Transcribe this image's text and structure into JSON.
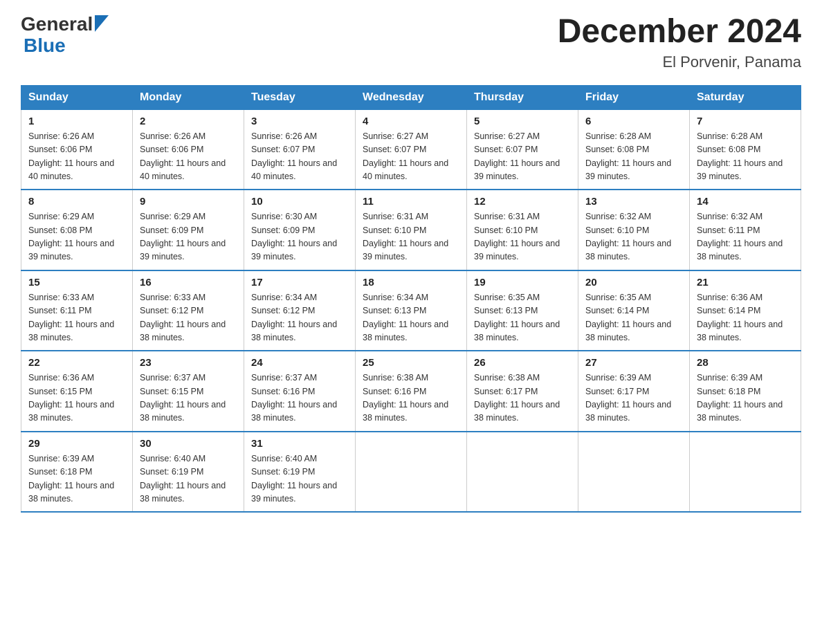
{
  "header": {
    "logo_general": "General",
    "logo_blue": "Blue",
    "title": "December 2024",
    "location": "El Porvenir, Panama"
  },
  "days_of_week": [
    "Sunday",
    "Monday",
    "Tuesday",
    "Wednesday",
    "Thursday",
    "Friday",
    "Saturday"
  ],
  "weeks": [
    [
      {
        "day": "1",
        "sunrise": "6:26 AM",
        "sunset": "6:06 PM",
        "daylight": "11 hours and 40 minutes."
      },
      {
        "day": "2",
        "sunrise": "6:26 AM",
        "sunset": "6:06 PM",
        "daylight": "11 hours and 40 minutes."
      },
      {
        "day": "3",
        "sunrise": "6:26 AM",
        "sunset": "6:07 PM",
        "daylight": "11 hours and 40 minutes."
      },
      {
        "day": "4",
        "sunrise": "6:27 AM",
        "sunset": "6:07 PM",
        "daylight": "11 hours and 40 minutes."
      },
      {
        "day": "5",
        "sunrise": "6:27 AM",
        "sunset": "6:07 PM",
        "daylight": "11 hours and 39 minutes."
      },
      {
        "day": "6",
        "sunrise": "6:28 AM",
        "sunset": "6:08 PM",
        "daylight": "11 hours and 39 minutes."
      },
      {
        "day": "7",
        "sunrise": "6:28 AM",
        "sunset": "6:08 PM",
        "daylight": "11 hours and 39 minutes."
      }
    ],
    [
      {
        "day": "8",
        "sunrise": "6:29 AM",
        "sunset": "6:08 PM",
        "daylight": "11 hours and 39 minutes."
      },
      {
        "day": "9",
        "sunrise": "6:29 AM",
        "sunset": "6:09 PM",
        "daylight": "11 hours and 39 minutes."
      },
      {
        "day": "10",
        "sunrise": "6:30 AM",
        "sunset": "6:09 PM",
        "daylight": "11 hours and 39 minutes."
      },
      {
        "day": "11",
        "sunrise": "6:31 AM",
        "sunset": "6:10 PM",
        "daylight": "11 hours and 39 minutes."
      },
      {
        "day": "12",
        "sunrise": "6:31 AM",
        "sunset": "6:10 PM",
        "daylight": "11 hours and 39 minutes."
      },
      {
        "day": "13",
        "sunrise": "6:32 AM",
        "sunset": "6:10 PM",
        "daylight": "11 hours and 38 minutes."
      },
      {
        "day": "14",
        "sunrise": "6:32 AM",
        "sunset": "6:11 PM",
        "daylight": "11 hours and 38 minutes."
      }
    ],
    [
      {
        "day": "15",
        "sunrise": "6:33 AM",
        "sunset": "6:11 PM",
        "daylight": "11 hours and 38 minutes."
      },
      {
        "day": "16",
        "sunrise": "6:33 AM",
        "sunset": "6:12 PM",
        "daylight": "11 hours and 38 minutes."
      },
      {
        "day": "17",
        "sunrise": "6:34 AM",
        "sunset": "6:12 PM",
        "daylight": "11 hours and 38 minutes."
      },
      {
        "day": "18",
        "sunrise": "6:34 AM",
        "sunset": "6:13 PM",
        "daylight": "11 hours and 38 minutes."
      },
      {
        "day": "19",
        "sunrise": "6:35 AM",
        "sunset": "6:13 PM",
        "daylight": "11 hours and 38 minutes."
      },
      {
        "day": "20",
        "sunrise": "6:35 AM",
        "sunset": "6:14 PM",
        "daylight": "11 hours and 38 minutes."
      },
      {
        "day": "21",
        "sunrise": "6:36 AM",
        "sunset": "6:14 PM",
        "daylight": "11 hours and 38 minutes."
      }
    ],
    [
      {
        "day": "22",
        "sunrise": "6:36 AM",
        "sunset": "6:15 PM",
        "daylight": "11 hours and 38 minutes."
      },
      {
        "day": "23",
        "sunrise": "6:37 AM",
        "sunset": "6:15 PM",
        "daylight": "11 hours and 38 minutes."
      },
      {
        "day": "24",
        "sunrise": "6:37 AM",
        "sunset": "6:16 PM",
        "daylight": "11 hours and 38 minutes."
      },
      {
        "day": "25",
        "sunrise": "6:38 AM",
        "sunset": "6:16 PM",
        "daylight": "11 hours and 38 minutes."
      },
      {
        "day": "26",
        "sunrise": "6:38 AM",
        "sunset": "6:17 PM",
        "daylight": "11 hours and 38 minutes."
      },
      {
        "day": "27",
        "sunrise": "6:39 AM",
        "sunset": "6:17 PM",
        "daylight": "11 hours and 38 minutes."
      },
      {
        "day": "28",
        "sunrise": "6:39 AM",
        "sunset": "6:18 PM",
        "daylight": "11 hours and 38 minutes."
      }
    ],
    [
      {
        "day": "29",
        "sunrise": "6:39 AM",
        "sunset": "6:18 PM",
        "daylight": "11 hours and 38 minutes."
      },
      {
        "day": "30",
        "sunrise": "6:40 AM",
        "sunset": "6:19 PM",
        "daylight": "11 hours and 38 minutes."
      },
      {
        "day": "31",
        "sunrise": "6:40 AM",
        "sunset": "6:19 PM",
        "daylight": "11 hours and 39 minutes."
      },
      null,
      null,
      null,
      null
    ]
  ]
}
